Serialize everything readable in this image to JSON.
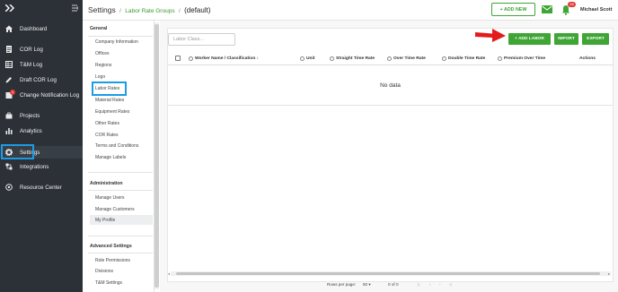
{
  "sidebar": {
    "logo": "",
    "items": [
      {
        "label": "Dashboard",
        "icon": "home-icon"
      },
      {
        "label": "COR Log",
        "icon": "document-icon"
      },
      {
        "label": "T&M Log",
        "icon": "table-icon"
      },
      {
        "label": "Draft COR Log",
        "icon": "pencil-icon"
      },
      {
        "label": "Change Notification Log",
        "icon": "notification-icon",
        "badge": "1"
      },
      {
        "label": "Projects",
        "icon": "briefcase-icon"
      },
      {
        "label": "Analytics",
        "icon": "bar-chart-icon"
      },
      {
        "label": "Settings",
        "icon": "gear-icon"
      },
      {
        "label": "Integrations",
        "icon": "integrations-icon"
      },
      {
        "label": "Resource Center",
        "icon": "help-circle-icon"
      }
    ]
  },
  "header": {
    "title": "Settings",
    "crumb_link": "Labor Rate Groups",
    "crumb_current": "(default)",
    "add_new_label": "+ ADD NEW",
    "notification_count": "28",
    "user_name": "Michael Scott"
  },
  "settings_nav": {
    "general_header": "General",
    "general_items": [
      "Company Information",
      "Offices",
      "Regions",
      "Logo",
      "Labor Rates",
      "Material Rates",
      "Equipment Rates",
      "Other Rates",
      "COR Rates",
      "Terms and Conditions",
      "Manage Labels"
    ],
    "admin_header": "Administration",
    "admin_items": [
      "Manage Users",
      "Manage Customers",
      "My Profile"
    ],
    "advanced_header": "Advanced Settings",
    "advanced_items": [
      "Role Permissions",
      "Divisions",
      "T&M Settings"
    ]
  },
  "main": {
    "search_placeholder": "Labor Class...",
    "add_labor_label": "+ ADD LABOR",
    "import_label": "IMPORT",
    "export_label": "EXPORT",
    "columns": [
      "Worker Name / Classification",
      "Unit",
      "Straight Time Rate",
      "Over Time Rate",
      "Double Time Rate",
      "Premium Over Time",
      "Actions"
    ],
    "no_data": "No data",
    "pagination": {
      "rows_per_page_label": "Rows per page:",
      "rows_per_page_value": "50",
      "range": "0 of 0"
    }
  },
  "colors": {
    "brand_green": "#3fa535",
    "sidebar_bg": "#2c3137",
    "highlight_blue": "#1c9be6",
    "arrow_red": "#e31b1b"
  }
}
